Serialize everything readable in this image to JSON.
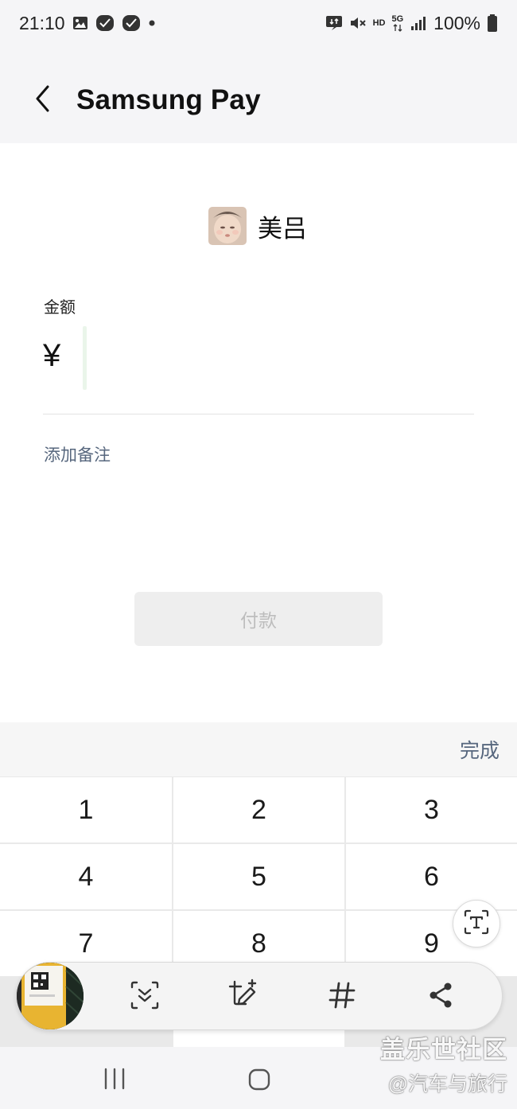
{
  "status_bar": {
    "time": "21:10",
    "network_label": "HD",
    "generation": "5G",
    "battery": "100%"
  },
  "app_bar": {
    "title": "Samsung Pay",
    "back_icon": "chevron-left-icon"
  },
  "payee": {
    "name": "美吕"
  },
  "amount": {
    "label": "金额",
    "currency_symbol": "¥",
    "value": ""
  },
  "note": {
    "add_label": "添加备注"
  },
  "pay_button": {
    "label": "付款",
    "enabled": false
  },
  "keyboard": {
    "done_label": "完成",
    "keys": [
      "1",
      "2",
      "3",
      "4",
      "5",
      "6",
      "7",
      "8",
      "9"
    ]
  },
  "screenshot_toolbar": {
    "tools": [
      "scroll-capture-icon",
      "crop-draw-icon",
      "hashtag-icon",
      "share-icon"
    ]
  },
  "watermark": {
    "line1": "盖乐世社区",
    "line2": "@汽车与旅行"
  },
  "colors": {
    "accent_text": "#57677e",
    "pay_disabled_bg": "#eeeeee",
    "pay_disabled_text": "#bdbdbd"
  }
}
